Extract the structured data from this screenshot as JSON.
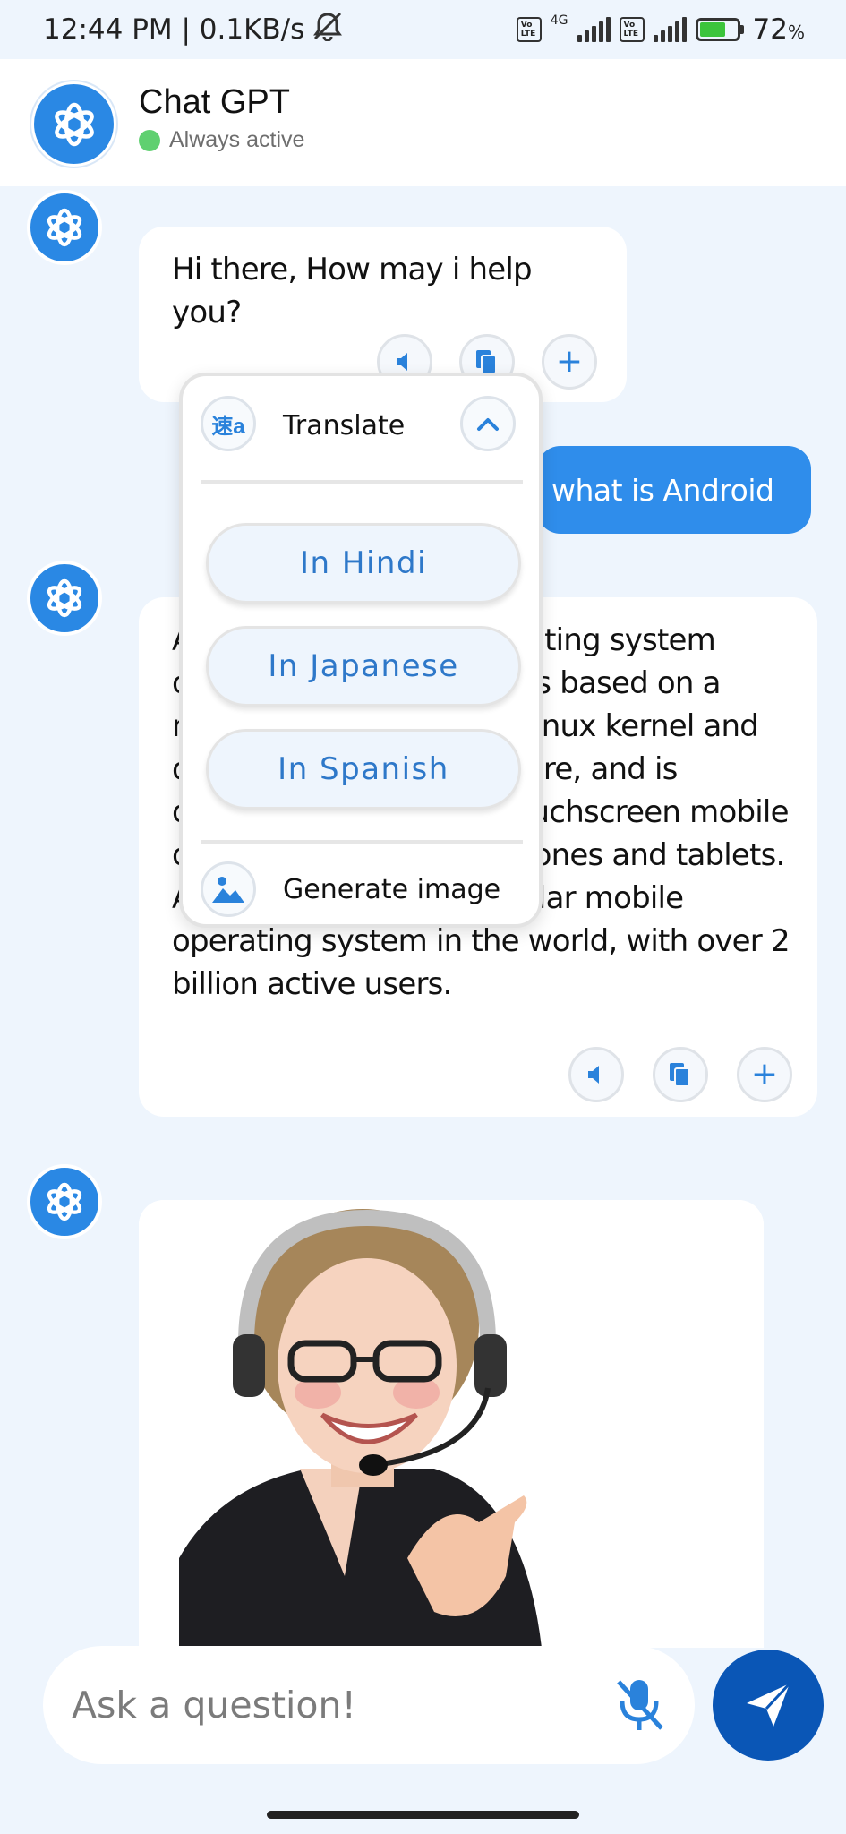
{
  "status_bar": {
    "time_speed": "12:44 PM | 0.1KB/s",
    "network": "4G",
    "volte_label": "Vo LTE",
    "battery": "72",
    "battery_unit": "%"
  },
  "header": {
    "title": "Chat GPT",
    "status": "Always active",
    "status_color": "#5fd070"
  },
  "messages": {
    "bot_greeting": "Hi there, How may i help you?",
    "user_question": "what is Android",
    "bot_answer": "Android is a mobile operating system developed by Google. It is based on a modified version of the Linux kernel and other open-source software, and is designed primarily for touchscreen mobile devices such as smartphones and tablets. Android is the most popular mobile operating system in the world, with over 2 billion active users."
  },
  "actions": {
    "speak_icon": "speaker-icon",
    "copy_icon": "copy-icon",
    "more_icon": "plus-icon",
    "more_glyph": "+"
  },
  "popup": {
    "translate_label": "Translate",
    "translate_icon_text": "速a",
    "languages": [
      "In Hindi",
      "In Japanese",
      "In Spanish"
    ],
    "generate_image_label": "Generate image"
  },
  "input": {
    "placeholder": "Ask a question!"
  },
  "colors": {
    "accent": "#2f8deb",
    "send": "#0a56b6",
    "background": "#eef5fd"
  }
}
